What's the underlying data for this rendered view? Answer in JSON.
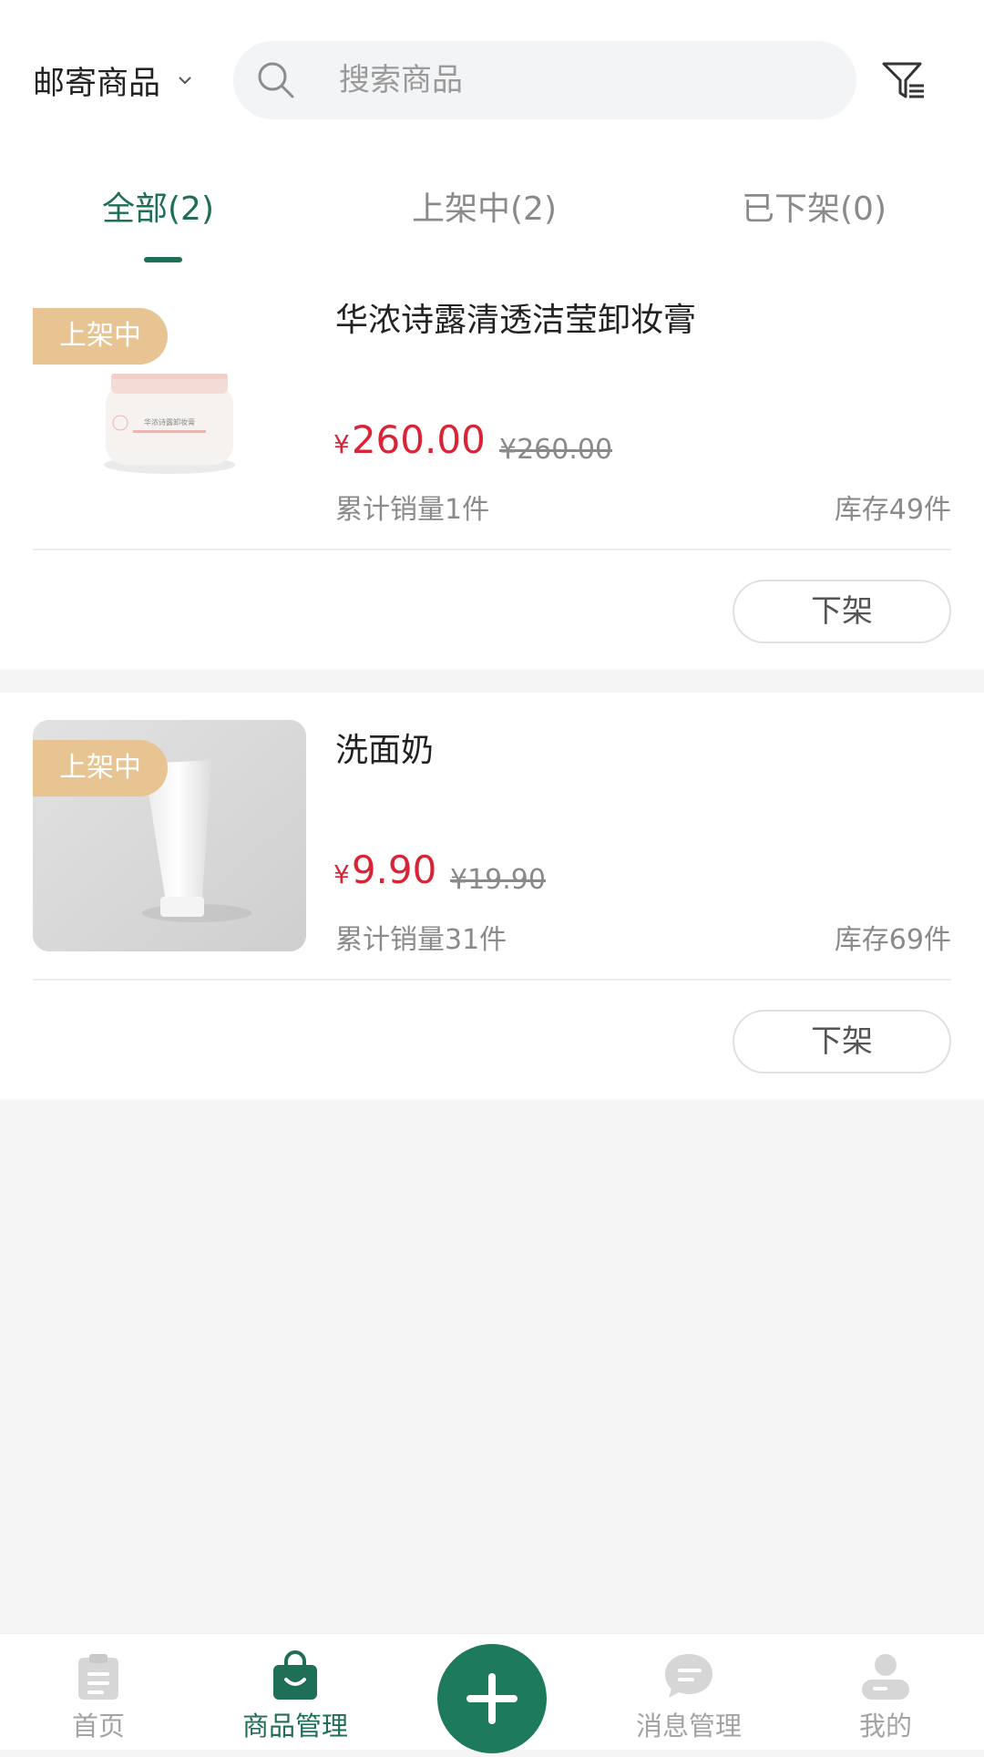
{
  "header": {
    "category_label": "邮寄商品",
    "search_placeholder": "搜索商品"
  },
  "tabs": [
    {
      "label": "全部(2)",
      "active": true
    },
    {
      "label": "上架中(2)",
      "active": false
    },
    {
      "label": "已下架(0)",
      "active": false
    }
  ],
  "products": [
    {
      "status_badge": "上架中",
      "name": "华浓诗露清透洁莹卸妆膏",
      "currency": "¥",
      "price": "260.00",
      "original_price": "¥260.00",
      "sales": "累计销量1件",
      "stock": "库存49件",
      "action_label": "下架",
      "thumb_label": "华浓诗露卸妆膏"
    },
    {
      "status_badge": "上架中",
      "name": "洗面奶",
      "currency": "¥",
      "price": "9.90",
      "original_price": "¥19.90",
      "sales": "累计销量31件",
      "stock": "库存69件",
      "action_label": "下架"
    }
  ],
  "bottom_nav": [
    {
      "label": "首页",
      "icon": "clipboard-icon",
      "active": false
    },
    {
      "label": "商品管理",
      "icon": "shopping-bag-icon",
      "active": true
    },
    {
      "label": "",
      "icon": "plus-icon",
      "active": false
    },
    {
      "label": "消息管理",
      "icon": "chat-bubble-icon",
      "active": false
    },
    {
      "label": "我的",
      "icon": "user-icon",
      "active": false
    }
  ],
  "colors": {
    "primary": "#1f6e57",
    "price": "#d62536",
    "badge": "#e8c493",
    "background": "#f5f5f6"
  }
}
